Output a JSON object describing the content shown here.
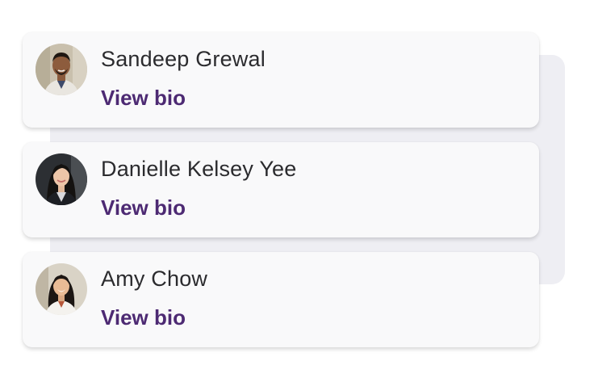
{
  "people": [
    {
      "name": "Sandeep Grewal",
      "link_label": "View bio"
    },
    {
      "name": "Danielle Kelsey Yee",
      "link_label": "View bio"
    },
    {
      "name": "Amy Chow",
      "link_label": "View bio"
    }
  ],
  "colors": {
    "link": "#4d2a73",
    "name_text": "#2b2b2e",
    "card_bg": "#f9f9fa",
    "backdrop": "#eeeef3"
  }
}
